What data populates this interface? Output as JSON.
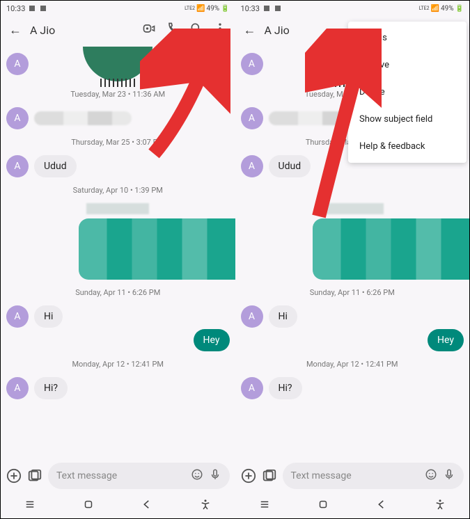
{
  "status": {
    "time": "10:33",
    "battery": "49%",
    "network": "LTE2"
  },
  "header": {
    "title": "A Jio"
  },
  "avatar_letter": "A",
  "timestamps": {
    "t1": "Tuesday, Mar 23 • 11:36 AM",
    "t2": "Thursday, Mar 25 • 3:07 PM",
    "t3": "Saturday, Apr 10 • 1:39 PM",
    "t4": "Sunday, Apr 11 • 6:26 PM",
    "t5": "Monday, Apr 12 • 12:41 PM"
  },
  "messages": {
    "udud": "Udud",
    "hi": "Hi",
    "hey": "Hey",
    "hi_q": "Hi?"
  },
  "input": {
    "placeholder": "Text message"
  },
  "menu": {
    "details": "Details",
    "archive": "Archive",
    "delete": "Delete",
    "show_subject": "Show subject field",
    "help": "Help & feedback"
  }
}
